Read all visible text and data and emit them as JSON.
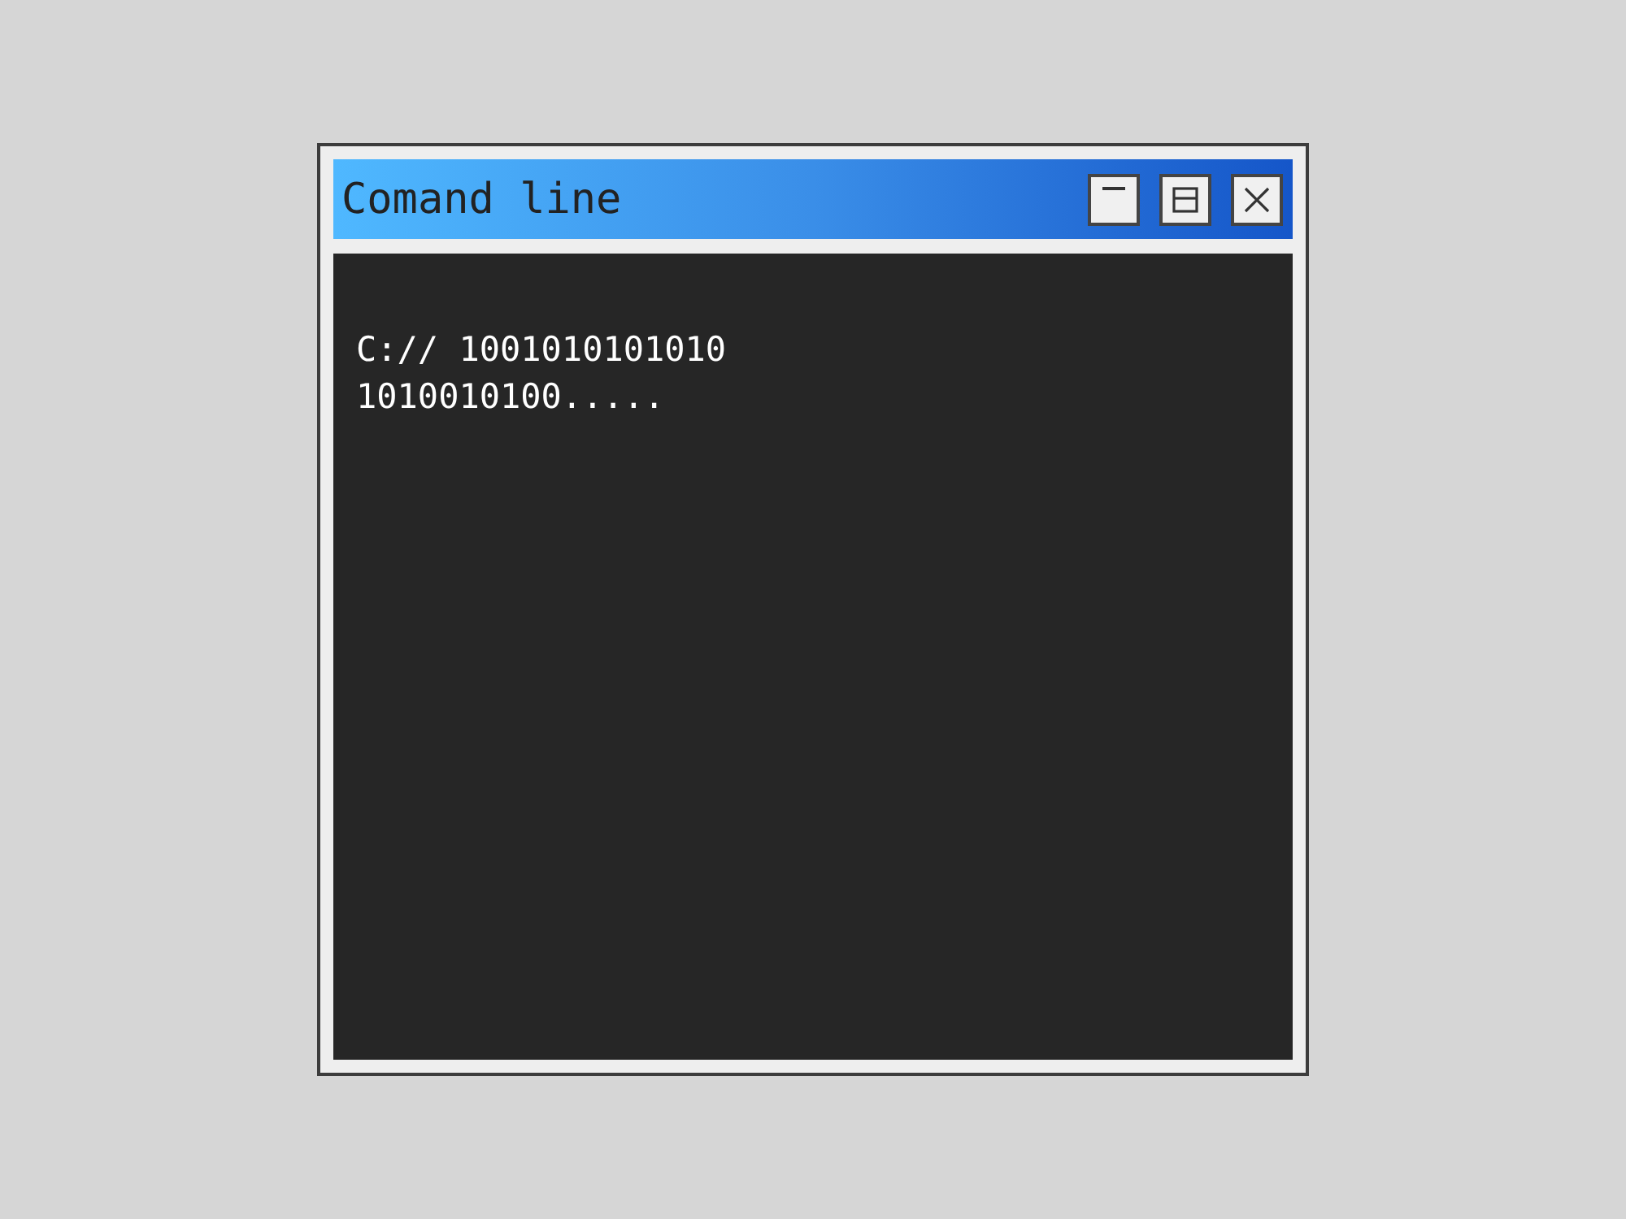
{
  "window": {
    "title": "Comand line",
    "buttons": [
      {
        "kind": "minimize"
      },
      {
        "kind": "maximize"
      },
      {
        "kind": "close"
      }
    ]
  },
  "terminal": {
    "lines": [
      "C:// 1001010101010",
      "1010010100....."
    ]
  }
}
